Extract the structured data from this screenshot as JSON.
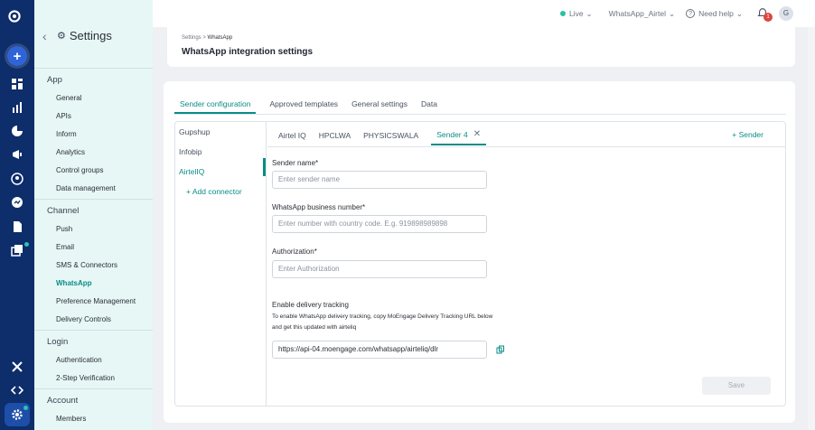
{
  "rail": {
    "icons": [
      "logo-icon",
      "create-icon",
      "dashboard-icon",
      "analytics-icon",
      "segment-icon",
      "campaign-icon",
      "user-icon",
      "engage-icon",
      "content-icon",
      "template-icon",
      "integrations-icon",
      "code-icon",
      "settings-icon"
    ]
  },
  "settings_panel": {
    "title": "Settings",
    "sections": [
      {
        "title": "App",
        "items": [
          "General",
          "APIs",
          "Inform",
          "Analytics",
          "Control groups",
          "Data management"
        ]
      },
      {
        "title": "Channel",
        "items": [
          "Push",
          "Email",
          "SMS & Connectors",
          "WhatsApp",
          "Preference Management",
          "Delivery Controls"
        ]
      },
      {
        "title": "Login",
        "items": [
          "Authentication",
          "2-Step Verification"
        ]
      },
      {
        "title": "Account",
        "items": [
          "Members"
        ]
      }
    ],
    "active_item": "WhatsApp"
  },
  "topbar": {
    "env": "Live",
    "workspace": "WhatsApp_Airtel",
    "help": "Need help",
    "notifications": "1",
    "avatar": "G",
    "live_color": "#2bc2a0"
  },
  "header": {
    "breadcrumb_parent": "Settings",
    "breadcrumb_sep": ">",
    "breadcrumb_current": "WhatsApp",
    "title": "WhatsApp integration settings"
  },
  "tabs": [
    "Sender configuration",
    "Approved templates",
    "General settings",
    "Data"
  ],
  "connectors": [
    "Gupshup",
    "Infobip",
    "AirtelIQ"
  ],
  "add_connector": "+ Add connector",
  "sender_tabs": [
    "Airtel IQ",
    "HPCLWA",
    "PHYSICSWALA",
    "Sender 4"
  ],
  "add_sender": "+ Sender",
  "form": {
    "sender_name_label": "Sender name*",
    "sender_name_placeholder": "Enter sender name",
    "number_label": "WhatsApp business number*",
    "number_placeholder": "Enter number with country code. E.g. 919898989898",
    "auth_label": "Authorization*",
    "auth_placeholder": "Enter Authorization",
    "tracking_label": "Enable delivery tracking",
    "tracking_help_1": "To enable WhatsApp delivery tracking, copy MoEngage Delivery Tracking URL below",
    "tracking_help_2": "and get this updated with airteliq",
    "tracking_url": "https://api-04.moengage.com/whatsapp/airteliq/dlr",
    "save": "Save"
  },
  "colors": {
    "accent": "#0a8d86",
    "rail": "#0d2d6b"
  }
}
